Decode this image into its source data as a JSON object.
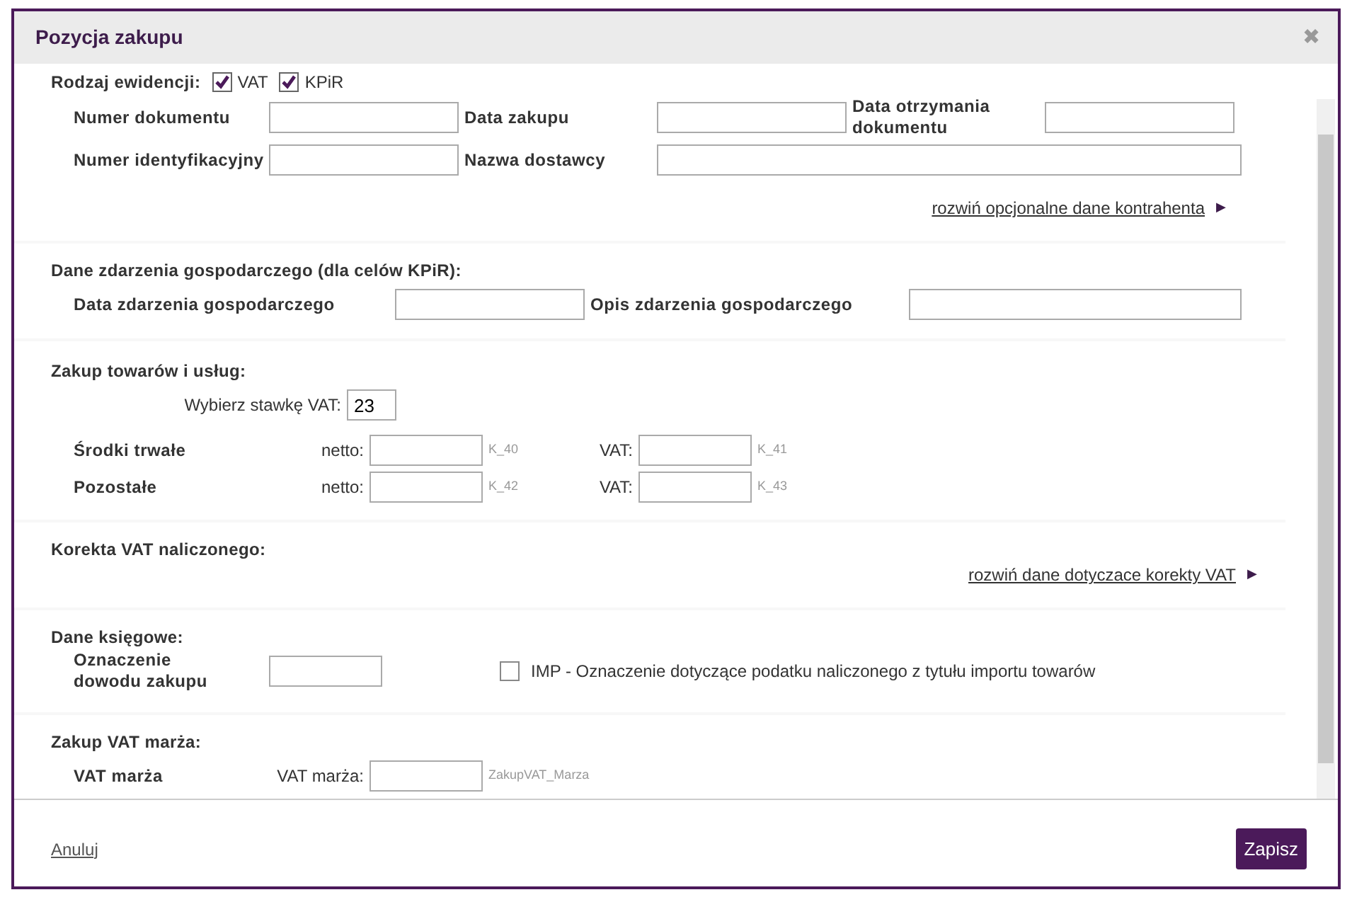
{
  "dialog": {
    "title": "Pozycja zakupu",
    "close_glyph": "✖"
  },
  "record_type": {
    "label": "Rodzaj ewidencji:",
    "options": [
      {
        "label": "VAT",
        "checked": true
      },
      {
        "label": "KPiR",
        "checked": true
      }
    ]
  },
  "document_fields": [
    {
      "label": "Numer dokumentu"
    },
    {
      "label": "Data zakupu"
    },
    {
      "label": "Data otrzymania dokumentu"
    },
    {
      "label": "Numer identyfikacyjny"
    },
    {
      "label": "Nazwa dostawcy"
    }
  ],
  "contractor_link": {
    "label": "rozwiń opcjonalne dane kontrahenta",
    "arrow": "▶"
  },
  "economic_event": {
    "title": "Dane zdarzenia gospodarczego (dla celów KPiR):",
    "fields": [
      {
        "label": "Data zdarzenia gospodarczego"
      },
      {
        "label": "Opis zdarzenia gospodarczego"
      }
    ]
  },
  "goods_services": {
    "title": "Zakup towarów i usług:",
    "rate_label": "Wybierz stawkę VAT:",
    "rate_value": "23",
    "rows": [
      {
        "label": "Środki trwałe",
        "net_label": "netto:",
        "net_code": "K_40",
        "vat_label": "VAT:",
        "vat_code": "K_41"
      },
      {
        "label": "Pozostałe",
        "net_label": "netto:",
        "net_code": "K_42",
        "vat_label": "VAT:",
        "vat_code": "K_43"
      }
    ]
  },
  "vat_correction": {
    "title": "Korekta VAT naliczonego:",
    "link": {
      "label": "rozwiń dane dotyczace korekty VAT",
      "arrow": "▶"
    }
  },
  "accounting": {
    "title": "Dane księgowe:",
    "field_label": "Oznaczenie dowodu zakupu",
    "imp": {
      "label": "IMP - Oznaczenie dotyczące podatku naliczonego z tytułu importu towarów",
      "checked": false
    }
  },
  "margin": {
    "title": "Zakup VAT marża:",
    "row_label": "VAT marża",
    "field_label": "VAT marża:",
    "code": "ZakupVAT_Marza"
  },
  "footer": {
    "cancel": "Anuluj",
    "save": "Zapisz"
  }
}
